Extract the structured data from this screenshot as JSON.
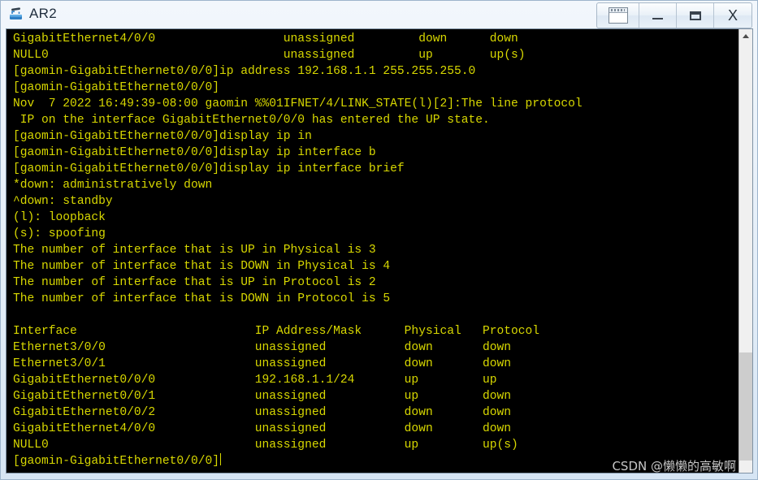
{
  "window": {
    "title": "AR2",
    "icon": "router-icon",
    "controls": [
      {
        "name": "restore-panel-button",
        "icon": "window-panel-icon",
        "label": ""
      },
      {
        "name": "minimize-button",
        "icon": "minimize-icon",
        "label": ""
      },
      {
        "name": "maximize-button",
        "icon": "maximize-icon",
        "label": ""
      },
      {
        "name": "close-button",
        "icon": "close-icon",
        "label": "X"
      }
    ]
  },
  "terminal": {
    "prompt": "[gaomin-GigabitEthernet0/0/0]",
    "text_color": "#d8d800",
    "background_color": "#000000",
    "lines": [
      "GigabitEthernet4/0/0                  unassigned         down      down",
      "NULL0                                 unassigned         up        up(s)",
      "[gaomin-GigabitEthernet0/0/0]ip address 192.168.1.1 255.255.255.0",
      "[gaomin-GigabitEthernet0/0/0]",
      "Nov  7 2022 16:49:39-08:00 gaomin %%01IFNET/4/LINK_STATE(l)[2]:The line protocol",
      " IP on the interface GigabitEthernet0/0/0 has entered the UP state.",
      "[gaomin-GigabitEthernet0/0/0]display ip in",
      "[gaomin-GigabitEthernet0/0/0]display ip interface b",
      "[gaomin-GigabitEthernet0/0/0]display ip interface brief",
      "*down: administratively down",
      "^down: standby",
      "(l): loopback",
      "(s): spoofing",
      "The number of interface that is UP in Physical is 3",
      "The number of interface that is DOWN in Physical is 4",
      "The number of interface that is UP in Protocol is 2",
      "The number of interface that is DOWN in Protocol is 5",
      "",
      "Interface                         IP Address/Mask      Physical   Protocol",
      "Ethernet3/0/0                     unassigned           down       down",
      "Ethernet3/0/1                     unassigned           down       down",
      "GigabitEthernet0/0/0              192.168.1.1/24       up         up",
      "GigabitEthernet0/0/1              unassigned           up         down",
      "GigabitEthernet0/0/2              unassigned           down       down",
      "GigabitEthernet4/0/0              unassigned           down       down",
      "NULL0                             unassigned           up         up(s)",
      "[gaomin-GigabitEthernet0/0/0]"
    ],
    "interface_table": {
      "headers": [
        "Interface",
        "IP Address/Mask",
        "Physical",
        "Protocol"
      ],
      "rows": [
        [
          "Ethernet3/0/0",
          "unassigned",
          "down",
          "down"
        ],
        [
          "Ethernet3/0/1",
          "unassigned",
          "down",
          "down"
        ],
        [
          "GigabitEthernet0/0/0",
          "192.168.1.1/24",
          "up",
          "up"
        ],
        [
          "GigabitEthernet0/0/1",
          "unassigned",
          "up",
          "down"
        ],
        [
          "GigabitEthernet0/0/2",
          "unassigned",
          "down",
          "down"
        ],
        [
          "GigabitEthernet4/0/0",
          "unassigned",
          "down",
          "down"
        ],
        [
          "NULL0",
          "unassigned",
          "up",
          "up(s)"
        ]
      ]
    },
    "counts": {
      "up_physical": "3",
      "down_physical": "4",
      "up_protocol": "2",
      "down_protocol": "5"
    },
    "legend": [
      "*down: administratively down",
      "^down: standby",
      "(l): loopback",
      "(s): spoofing"
    ],
    "commands": [
      "ip address 192.168.1.1 255.255.255.0",
      "display ip in",
      "display ip interface b",
      "display ip interface brief"
    ],
    "syslog": "Nov  7 2022 16:49:39-08:00 gaomin %%01IFNET/4/LINK_STATE(l)[2]:The line protocol IP on the interface GigabitEthernet0/0/0 has entered the UP state."
  },
  "scrollbar": {
    "up_arrow": "chevron-up-icon",
    "position": "bottom"
  },
  "watermark": {
    "text": "CSDN @懒懒的高敏啊"
  }
}
